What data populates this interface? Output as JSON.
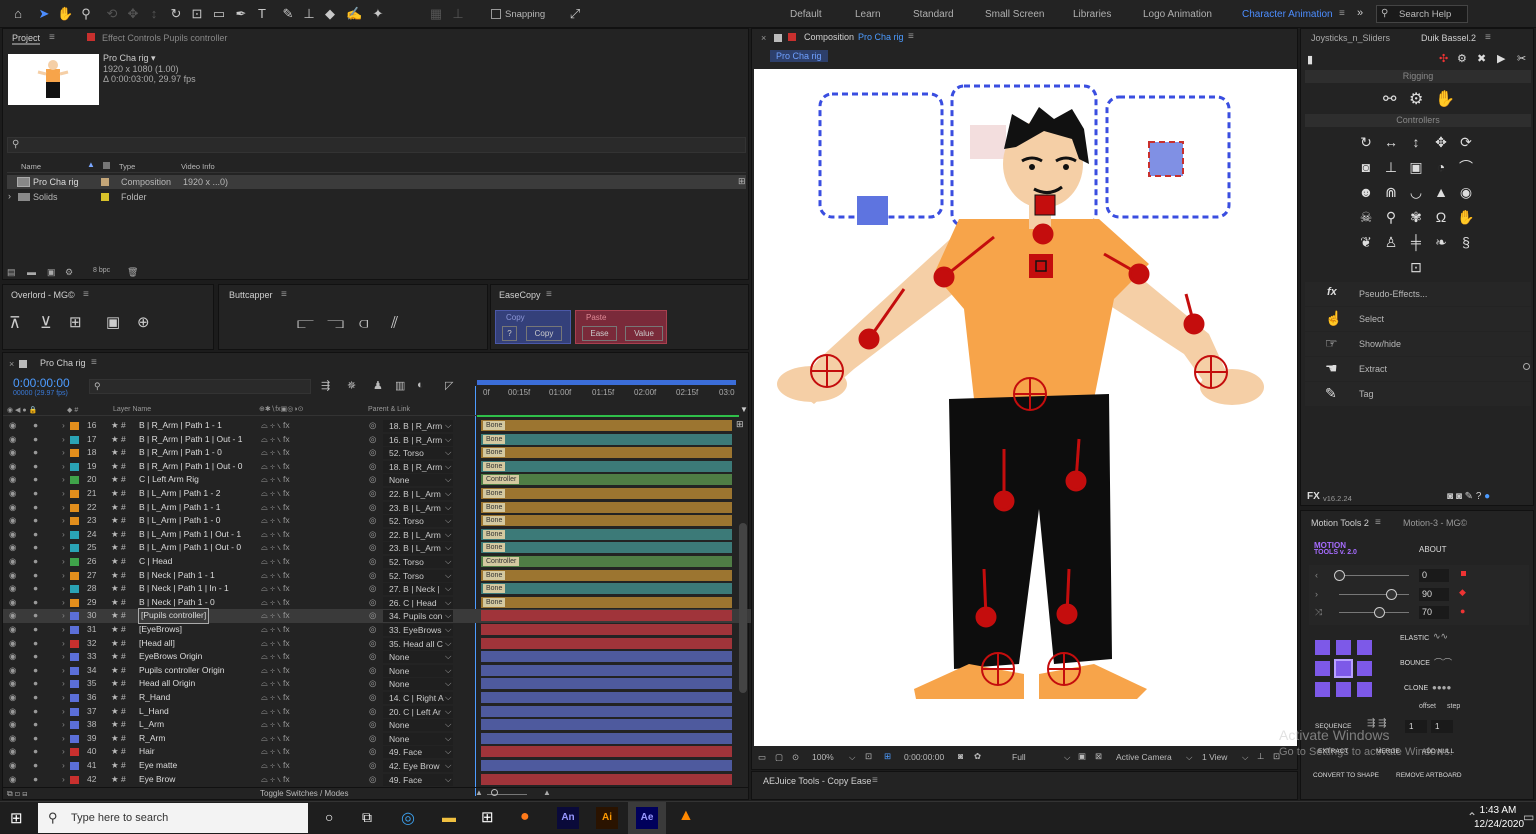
{
  "toolbar": {
    "snapping": "Snapping",
    "search_help": "Search Help",
    "workspaces": [
      "Default",
      "Learn",
      "Standard",
      "Small Screen",
      "Libraries",
      "Logo Animation",
      "Character Animation"
    ]
  },
  "project": {
    "tab": "Project",
    "effect_controls": "Effect Controls Pupils controller",
    "comp_name": "Pro Cha rig ▾",
    "comp_size": "1920 x 1080 (1.00)",
    "comp_duration": "Δ 0:00:03:00, 29.97 fps",
    "col_name": "Name",
    "col_type": "Type",
    "col_info": "Video Info",
    "items": [
      {
        "name": "Pro Cha rig",
        "type": "Composition",
        "info": "1920 x ...0)"
      },
      {
        "name": "Solids",
        "type": "Folder",
        "info": ""
      }
    ],
    "bpc": "8 bpc"
  },
  "panels": {
    "overlord": "Overlord - MG©",
    "buttcapper": "Buttcapper",
    "easecopy": "EaseCopy",
    "copy_label": "Copy",
    "paste_label": "Paste",
    "q": "?",
    "copy_btn": "Copy",
    "ease_btn": "Ease",
    "value_btn": "Value"
  },
  "timeline": {
    "tab": "Pro Cha rig",
    "timecode": "0:00:00:00",
    "fps": "00000 (29.97 fps)",
    "col_layer": "Layer Name",
    "col_parent": "Parent & Link",
    "ticks": [
      "0f",
      "00:15f",
      "01:00f",
      "01:15f",
      "02:00f",
      "02:15f",
      "03:0"
    ],
    "toggle": "Toggle Switches / Modes",
    "layers": [
      {
        "n": "16",
        "name": "B | R_Arm | Path 1 - 1",
        "parent": "18. B | R_Arm",
        "color": "#e28e1c",
        "bar": "#9c7530",
        "chip": "Bone"
      },
      {
        "n": "17",
        "name": "B | R_Arm | Path 1 | Out - 1",
        "parent": "16. B | R_Arm",
        "color": "#2aa3b5",
        "bar": "#3c7a78",
        "chip": "Bone"
      },
      {
        "n": "18",
        "name": "B | R_Arm | Path 1 - 0",
        "parent": "52. Torso",
        "color": "#e28e1c",
        "bar": "#9c7530",
        "chip": "Bone"
      },
      {
        "n": "19",
        "name": "B | R_Arm | Path 1 | Out - 0",
        "parent": "18. B | R_Arm",
        "color": "#2aa3b5",
        "bar": "#3c7a78",
        "chip": "Bone"
      },
      {
        "n": "20",
        "name": "C | Left Arm Rig",
        "parent": "None",
        "color": "#3fa34a",
        "bar": "#4f7d45",
        "chip": "Controller"
      },
      {
        "n": "21",
        "name": "B | L_Arm | Path 1 - 2",
        "parent": "22. B | L_Arm",
        "color": "#e28e1c",
        "bar": "#9c7530",
        "chip": "Bone"
      },
      {
        "n": "22",
        "name": "B | L_Arm | Path 1 - 1",
        "parent": "23. B | L_Arm",
        "color": "#e28e1c",
        "bar": "#9c7530",
        "chip": "Bone"
      },
      {
        "n": "23",
        "name": "B | L_Arm | Path 1 - 0",
        "parent": "52. Torso",
        "color": "#e28e1c",
        "bar": "#9c7530",
        "chip": "Bone"
      },
      {
        "n": "24",
        "name": "B | L_Arm | Path 1 | Out - 1",
        "parent": "22. B | L_Arm",
        "color": "#2aa3b5",
        "bar": "#3c7a78",
        "chip": "Bone"
      },
      {
        "n": "25",
        "name": "B | L_Arm | Path 1 | Out - 0",
        "parent": "23. B | L_Arm",
        "color": "#2aa3b5",
        "bar": "#3c7a78",
        "chip": "Bone"
      },
      {
        "n": "26",
        "name": "C | Head",
        "parent": "52. Torso",
        "color": "#3fa34a",
        "bar": "#4f7d45",
        "chip": "Controller"
      },
      {
        "n": "27",
        "name": "B | Neck | Path 1 - 1",
        "parent": "52. Torso",
        "color": "#e28e1c",
        "bar": "#9c7530",
        "chip": "Bone"
      },
      {
        "n": "28",
        "name": "B | Neck | Path 1 | In - 1",
        "parent": "27. B | Neck |",
        "color": "#2aa3b5",
        "bar": "#3c7a78",
        "chip": "Bone"
      },
      {
        "n": "29",
        "name": "B | Neck | Path 1 - 0",
        "parent": "26. C | Head",
        "color": "#e28e1c",
        "bar": "#9c7530",
        "chip": "Bone"
      },
      {
        "n": "30",
        "name": "[Pupils controller]",
        "parent": "34. Pupils con",
        "color": "#5b6fd8",
        "bar": "#a0343a",
        "chip": ""
      },
      {
        "n": "31",
        "name": "[EyeBrows]",
        "parent": "33. EyeBrows",
        "color": "#5b6fd8",
        "bar": "#a0343a",
        "chip": ""
      },
      {
        "n": "32",
        "name": "[Head all]",
        "parent": "35. Head all C",
        "color": "#c8302e",
        "bar": "#a0343a",
        "chip": ""
      },
      {
        "n": "33",
        "name": "EyeBrows Origin",
        "parent": "None",
        "color": "#5b6fd8",
        "bar": "#4e5a9e",
        "chip": ""
      },
      {
        "n": "34",
        "name": "Pupils controller Origin",
        "parent": "None",
        "color": "#5b6fd8",
        "bar": "#4e5a9e",
        "chip": ""
      },
      {
        "n": "35",
        "name": "Head all Origin",
        "parent": "None",
        "color": "#5b6fd8",
        "bar": "#4e5a9e",
        "chip": ""
      },
      {
        "n": "36",
        "name": "R_Hand",
        "parent": "14. C | Right A",
        "color": "#5b6fd8",
        "bar": "#4e5a9e",
        "chip": ""
      },
      {
        "n": "37",
        "name": "L_Hand",
        "parent": "20. C | Left Ar",
        "color": "#5b6fd8",
        "bar": "#4e5a9e",
        "chip": ""
      },
      {
        "n": "38",
        "name": "L_Arm",
        "parent": "None",
        "color": "#5b6fd8",
        "bar": "#4e5a9e",
        "chip": ""
      },
      {
        "n": "39",
        "name": "R_Arm",
        "parent": "None",
        "color": "#5b6fd8",
        "bar": "#4e5a9e",
        "chip": ""
      },
      {
        "n": "40",
        "name": "Hair",
        "parent": "49. Face",
        "color": "#c8302e",
        "bar": "#a0343a",
        "chip": ""
      },
      {
        "n": "41",
        "name": "Eye matte",
        "parent": "42. Eye Brow",
        "color": "#5b6fd8",
        "bar": "#4e5a9e",
        "chip": ""
      },
      {
        "n": "42",
        "name": "Eye Brow",
        "parent": "49. Face",
        "color": "#c8302e",
        "bar": "#a0343a",
        "chip": ""
      }
    ]
  },
  "composition": {
    "tab": "Composition",
    "name": "Pro Cha rig",
    "crumb": "Pro Cha rig",
    "zoom": "100%",
    "time": "0:00:00:00",
    "quality": "Full",
    "camera": "Active Camera",
    "view": "1 View"
  },
  "aejuice": {
    "title": "AEJuice Tools - Copy Ease"
  },
  "duik": {
    "tab1": "Joysticks_n_Sliders",
    "tab2": "Duik Bassel.2",
    "rigging": "Rigging",
    "controllers": "Controllers",
    "menu": [
      "Pseudo-Effects...",
      "Select",
      "Show/hide",
      "Extract",
      "Tag"
    ],
    "version": "v16.2.24"
  },
  "motion": {
    "tab1": "Motion Tools 2",
    "tab2": "Motion-3 - MG©",
    "logo1": "MOTION",
    "logo2": "TOOLS v. 2.0",
    "about": "ABOUT",
    "v1": "0",
    "v2": "90",
    "v3": "70",
    "elastic": "ELASTIC",
    "bounce": "BOUNCE",
    "clone": "CLONE",
    "offset": "offset",
    "step": "step",
    "sequence": "SEQUENCE",
    "extract": "EXTRACT",
    "merge": "MERGE",
    "add_null": "ADD NULL",
    "convert": "CONVERT TO SHAPE",
    "remove": "REMOVE ARTBOARD",
    "seq1": "1",
    "seq2": "1"
  },
  "watermark": {
    "line1": "Activate Windows",
    "line2": "Go to Settings to activate Windows."
  },
  "taskbar": {
    "search": "Type here to search",
    "time": "1:43 AM",
    "date": "12/24/2020",
    "apps": [
      "An",
      "Ai",
      "Ae"
    ]
  }
}
